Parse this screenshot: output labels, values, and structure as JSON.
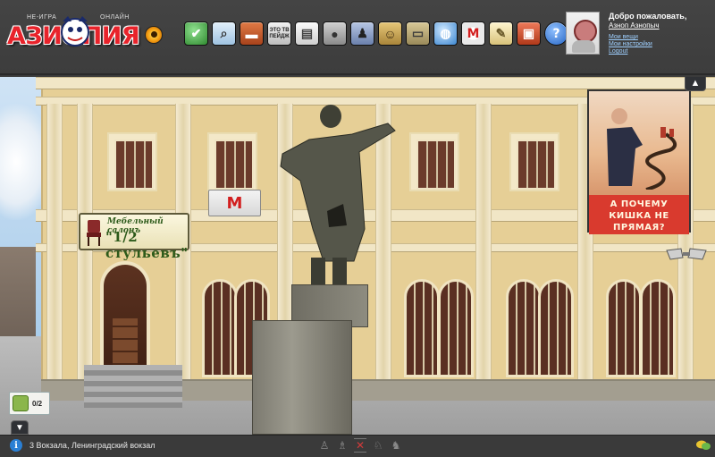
{
  "header": {
    "logo_text": "АЗИОПИЯ",
    "logo_tag_left": "НЕ-ИГРА",
    "logo_tag_right": "ОНЛАЙН",
    "toolbar": [
      {
        "name": "check-icon",
        "color": "#3aa83a",
        "glyph": "✔"
      },
      {
        "name": "search-icon",
        "color": "#b9d7ef",
        "glyph": "🔍"
      },
      {
        "name": "briefcase-icon",
        "color": "#c55a2b",
        "glyph": ""
      },
      {
        "name": "eto-tvoi-peidzh-icon",
        "color": "#d9d9d9",
        "label": "ЭТО ТВ ПЕЙДЖ"
      },
      {
        "name": "newspaper-icon",
        "color": "#e8e8e8",
        "glyph": "▤"
      },
      {
        "name": "piggy-bank-icon",
        "color": "#a9a9a9",
        "glyph": ""
      },
      {
        "name": "people-icon",
        "color": "#8aa0c8",
        "glyph": ""
      },
      {
        "name": "portrait-icon",
        "color": "#c9a860",
        "glyph": ""
      },
      {
        "name": "car-icon",
        "color": "#b8a87a",
        "glyph": ""
      },
      {
        "name": "globe-icon",
        "color": "#5aa0e0",
        "glyph": ""
      },
      {
        "name": "metro-icon",
        "color": "#f0f0f0",
        "glyph": "М"
      },
      {
        "name": "notes-icon",
        "color": "#efe0a8",
        "glyph": ""
      },
      {
        "name": "tv-icon",
        "color": "#d84a2a",
        "glyph": ""
      },
      {
        "name": "help-icon",
        "color": "#3b7fd8",
        "glyph": "?"
      }
    ],
    "user": {
      "welcome": "Добро пожаловать,",
      "name": "Азноп Азнопыч",
      "links": [
        "Мои вещи",
        "Мои настройки",
        "Logout"
      ]
    }
  },
  "scene": {
    "sign_salon_line1": "Мебельный салонъ",
    "sign_salon_line2": "\"1/2 стульевъ\"",
    "metro_sign": "М",
    "poster_caption": "А ПОЧЕМУ КИШКА НЕ ПРЯМАЯ?",
    "chat_count": "0/2",
    "scroll_up": "▲",
    "toggle_down": "▼"
  },
  "footer": {
    "info": "i",
    "location": "3 Вокзала, Ленинградский вокзал",
    "nav_icons": [
      "walk-icon",
      "stand-icon",
      "close-icon",
      "person-icon",
      "run-icon"
    ]
  }
}
